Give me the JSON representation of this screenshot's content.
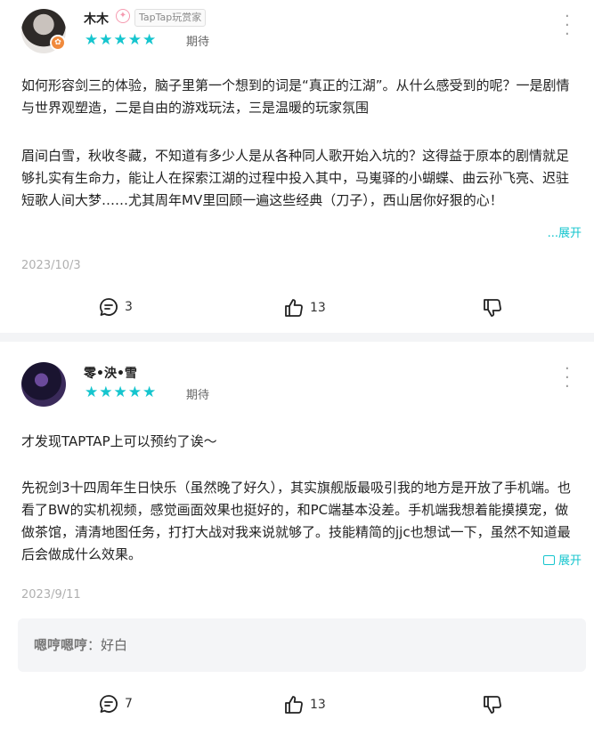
{
  "reviews": [
    {
      "user": "木木",
      "tag": "TapTap玩赏家",
      "rating_stars": 5,
      "stars": "★★★★★",
      "status": "期待",
      "paragraphs": [
        "如何形容剑三的体验，脑子里第一个想到的词是“真正的江湖”。从什么感受到的呢？一是剧情与世界观塑造，二是自由的游戏玩法，三是温暖的玩家氛围",
        "眉间白雪，秋收冬藏，不知道有多少人是从各种同人歌开始入坑的？这得益于原本的剧情就足够扎实有生命力，能让人在探索江湖的过程中投入其中，马嵬驿的小蝴蝶、曲云孙飞亮、迟驻短歌人间大梦……尤其周年MV里回顾一遍这些经典（刀子），西山居你好狠的心！"
      ],
      "expand": "...展开",
      "date": "2023/10/3",
      "comments": "3",
      "likes": "13"
    },
    {
      "user": "零•泱•雪",
      "rating_stars": 5,
      "stars": "★★★★★",
      "status": "期待",
      "paragraphs": [
        "才发现TAPTAP上可以预约了诶～",
        "先祝剑3十四周年生日快乐（虽然晚了好久），其实旗舰版最吸引我的地方是开放了手机端。也看了BW的实机视频，感觉画面效果也挺好的，和PC端基本没差。手机端我想着能摸摸宠，做做茶馆，清清地图任务，打打大战对我来说就够了。技能精简的jjc也想试一下，虽然不知道最后会做成什么效果。"
      ],
      "expand": "展开",
      "date": "2023/9/11",
      "reply": {
        "name": "嗯哼嗯哼",
        "separator": "：",
        "text": "好白"
      },
      "comments": "7",
      "likes": "13"
    }
  ],
  "icons": {
    "more": "more-vertical-icon",
    "comment": "comment-icon",
    "like": "thumbs-up-icon",
    "dislike": "thumbs-down-icon"
  },
  "colors": {
    "accent": "#15c5ce",
    "divider": "#f3f4f6",
    "reply_bg": "#f4f5f7"
  }
}
